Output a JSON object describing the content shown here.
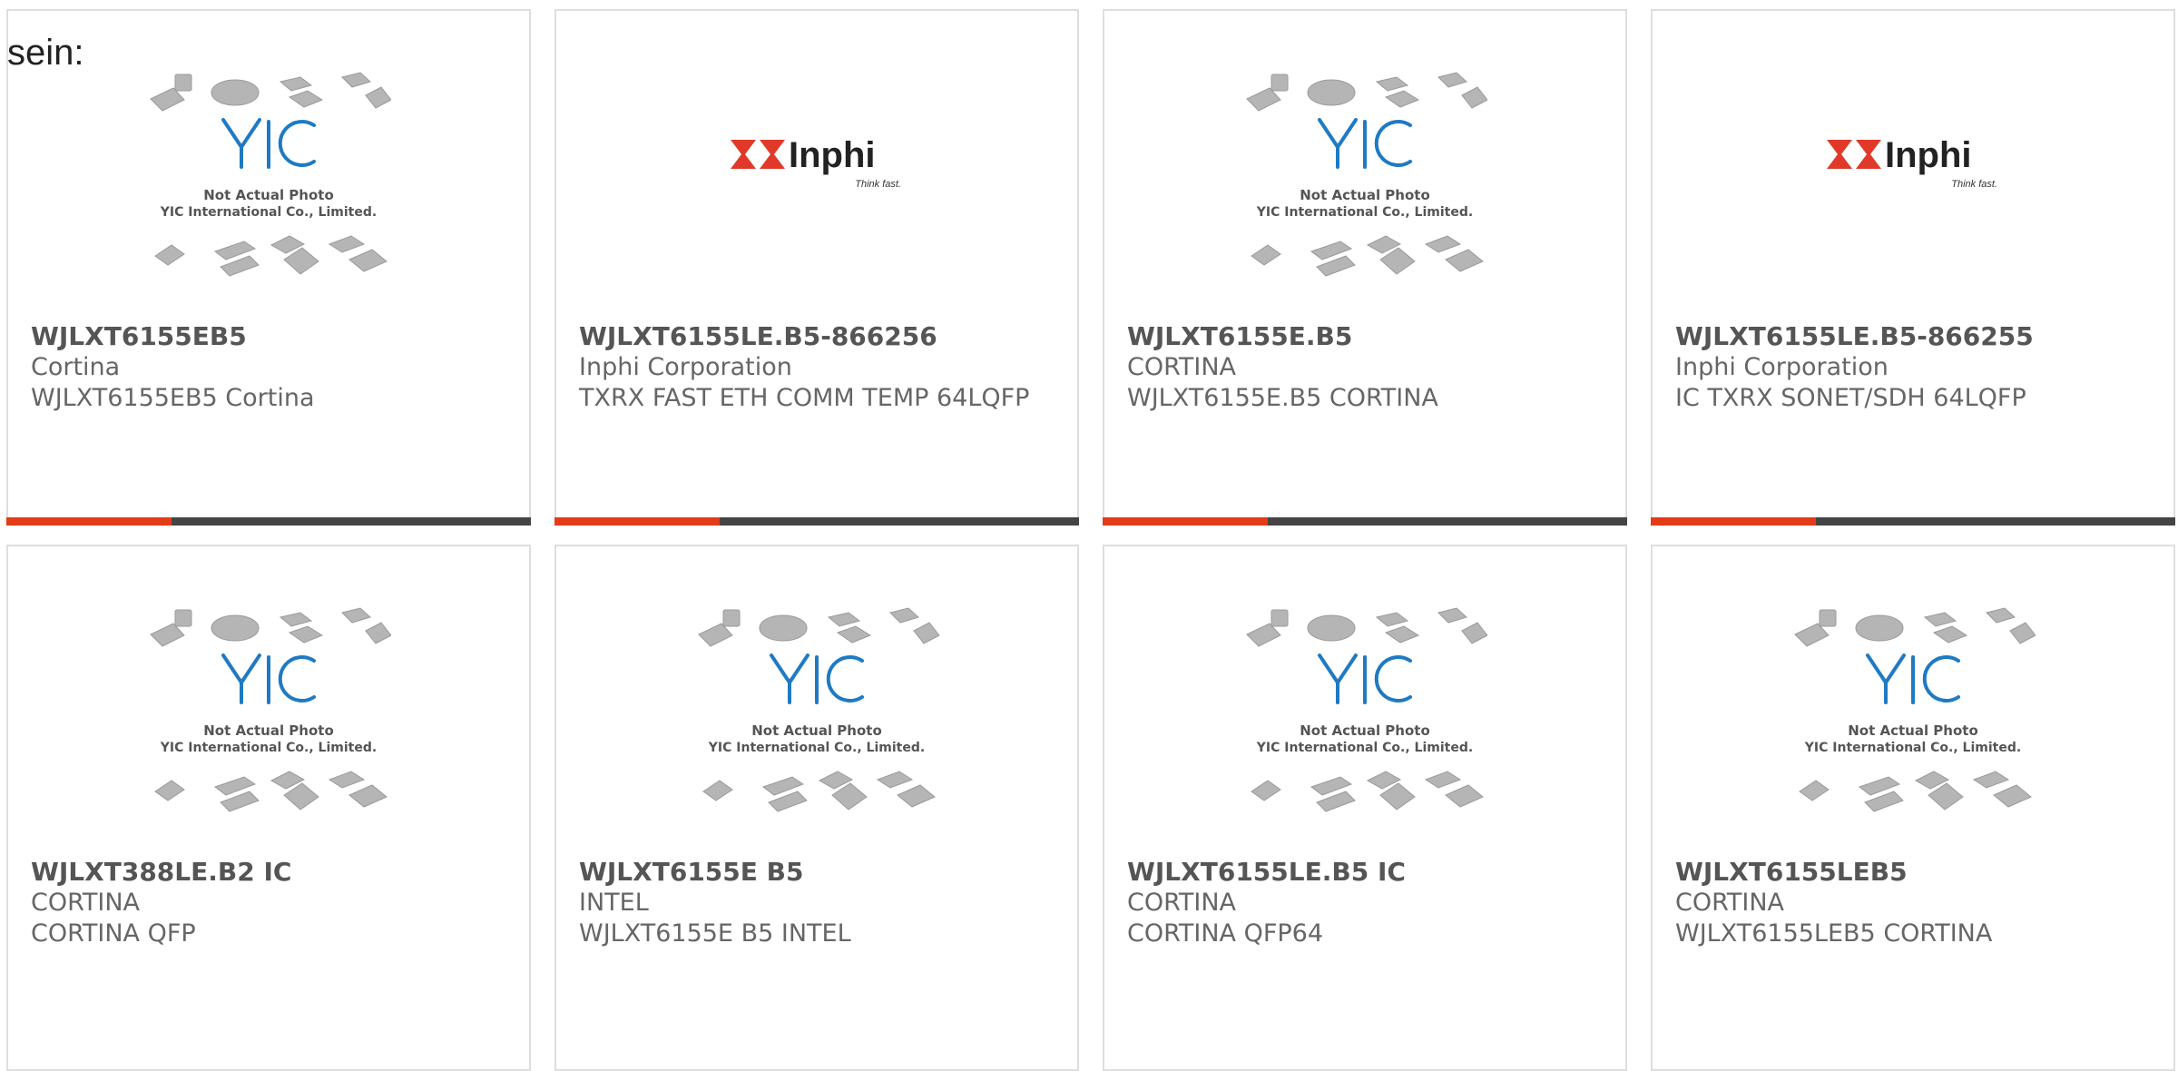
{
  "lead_text": "sein:",
  "placeholder": {
    "line1": "Not Actual Photo",
    "line2": "YIC International Co., Limited."
  },
  "inphi": {
    "brand": "Inphi",
    "tagline": "Think fast."
  },
  "colors": {
    "accent": "#e43b19",
    "bar": "#444444",
    "text": "#666666",
    "inphi_red": "#e0392a"
  },
  "products": [
    {
      "part": "WJLXT6155EB5",
      "manufacturer": "Cortina",
      "description": "WJLXT6155EB5 Cortina",
      "image": "yic-placeholder"
    },
    {
      "part": "WJLXT6155LE.B5-866256",
      "manufacturer": "Inphi Corporation",
      "description": "TXRX FAST ETH COMM TEMP 64LQFP",
      "image": "inphi-logo"
    },
    {
      "part": "WJLXT6155E.B5",
      "manufacturer": "CORTINA",
      "description": "WJLXT6155E.B5 CORTINA",
      "image": "yic-placeholder"
    },
    {
      "part": "WJLXT6155LE.B5-866255",
      "manufacturer": "Inphi Corporation",
      "description": "IC TXRX SONET/SDH 64LQFP",
      "image": "inphi-logo"
    },
    {
      "part": "WJLXT388LE.B2 IC",
      "manufacturer": "CORTINA",
      "description": "CORTINA QFP",
      "image": "yic-placeholder"
    },
    {
      "part": "WJLXT6155E B5",
      "manufacturer": "INTEL",
      "description": "WJLXT6155E B5 INTEL",
      "image": "yic-placeholder"
    },
    {
      "part": "WJLXT6155LE.B5 IC",
      "manufacturer": "CORTINA",
      "description": "CORTINA QFP64",
      "image": "yic-placeholder"
    },
    {
      "part": "WJLXT6155LEB5",
      "manufacturer": "CORTINA",
      "description": "WJLXT6155LEB5 CORTINA",
      "image": "yic-placeholder"
    }
  ]
}
